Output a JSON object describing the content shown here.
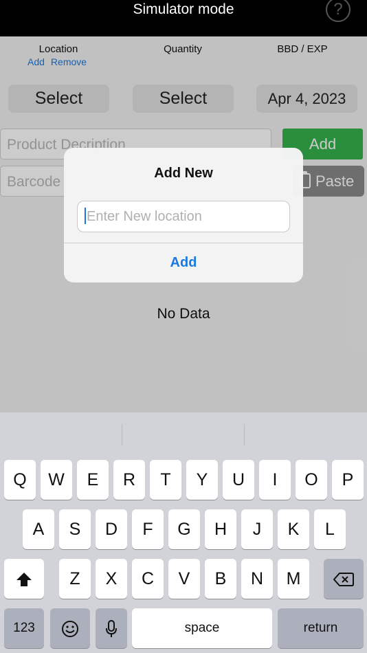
{
  "topbar": {
    "title": "Simulator mode",
    "help_glyph": "?"
  },
  "columns": {
    "location": "Location",
    "quantity": "Quantity",
    "bbd": "BBD / EXP"
  },
  "location_links": {
    "add": "Add",
    "remove": "Remove"
  },
  "selectors": {
    "location_select": "Select",
    "quantity_select": "Select",
    "date": "Apr 4, 2023"
  },
  "fields": {
    "description_placeholder": "Product Decription",
    "barcode_placeholder": "Barcode"
  },
  "buttons": {
    "add": "Add",
    "paste": "Paste"
  },
  "list": {
    "empty_text": "No Data"
  },
  "dialog": {
    "title": "Add New",
    "input_placeholder": "Enter New location",
    "add_label": "Add"
  },
  "keyboard": {
    "row1": [
      "Q",
      "W",
      "E",
      "R",
      "T",
      "Y",
      "U",
      "I",
      "O",
      "P"
    ],
    "row2": [
      "A",
      "S",
      "D",
      "F",
      "G",
      "H",
      "J",
      "K",
      "L"
    ],
    "row3": [
      "Z",
      "X",
      "C",
      "V",
      "B",
      "N",
      "M"
    ],
    "numbers_label": "123",
    "space_label": "space",
    "return_label": "return",
    "icons": {
      "shift": "shift-icon",
      "delete": "delete-icon",
      "emoji": "emoji-icon",
      "mic": "microphone-icon"
    }
  },
  "colors": {
    "add_button": "#34b34c",
    "link": "#1a7ae0",
    "paste_button": "#8a8a8a"
  }
}
